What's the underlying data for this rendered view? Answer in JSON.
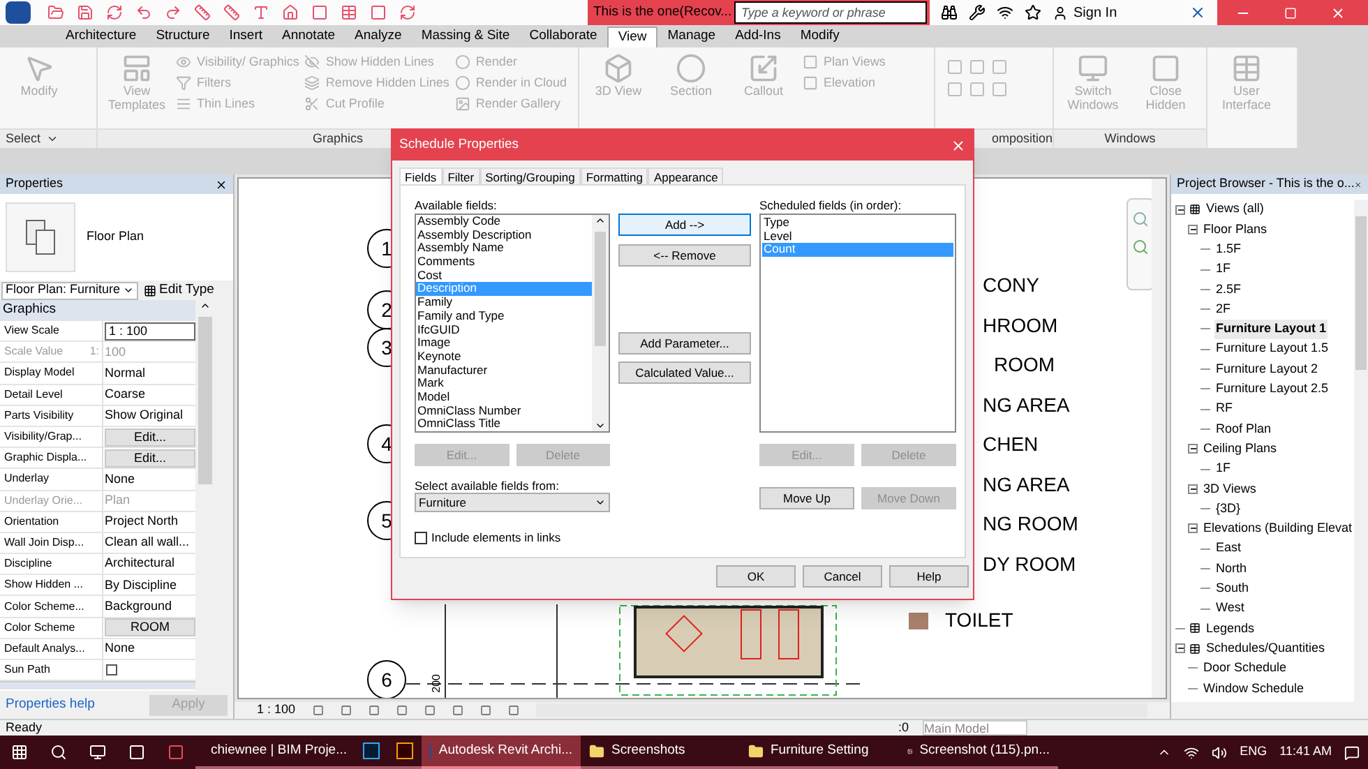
{
  "title_bar": {
    "title": "This is the one(Recov...",
    "search": {
      "placeholder": "Type a keyword or phrase"
    },
    "sign_in": "Sign In"
  },
  "ribbon_tabs": [
    {
      "label": "Architecture",
      "selected": false
    },
    {
      "label": "Structure",
      "selected": false
    },
    {
      "label": "Insert",
      "selected": false
    },
    {
      "label": "Annotate",
      "selected": false
    },
    {
      "label": "Analyze",
      "selected": false
    },
    {
      "label": "Massing & Site",
      "selected": false
    },
    {
      "label": "Collaborate",
      "selected": false
    },
    {
      "label": "View",
      "selected": true
    },
    {
      "label": "Manage",
      "selected": false
    },
    {
      "label": "Add-Ins",
      "selected": false
    },
    {
      "label": "Modify",
      "selected": false
    }
  ],
  "ribbon": [
    {
      "label": "Select",
      "columns": [
        [
          {
            "label": "Modify",
            "kind": "large"
          }
        ]
      ]
    },
    {
      "label": "Graphics",
      "columns": [
        [
          {
            "label": "View Templates",
            "kind": "large"
          }
        ],
        [
          {
            "label": "Visibility/ Graphics",
            "kind": "small"
          },
          {
            "label": "Filters",
            "kind": "small"
          },
          {
            "label": "Thin Lines",
            "kind": "small"
          }
        ],
        [
          {
            "label": "Show Hidden Lines",
            "kind": "small"
          },
          {
            "label": "Remove Hidden Lines",
            "kind": "small"
          },
          {
            "label": "Cut Profile",
            "kind": "small"
          }
        ],
        [
          {
            "label": "Render",
            "kind": "small"
          },
          {
            "label": "Render in Cloud",
            "kind": "small"
          },
          {
            "label": "Render Gallery",
            "kind": "small"
          }
        ]
      ]
    },
    {
      "columns": [
        [
          {
            "label": "3D View",
            "kind": "large"
          }
        ],
        [
          {
            "label": "Section",
            "kind": "large"
          }
        ],
        [
          {
            "label": "Callout",
            "kind": "large"
          }
        ],
        [
          {
            "label": "Plan Views",
            "kind": "small"
          },
          {
            "label": "Elevation",
            "kind": "small"
          }
        ]
      ]
    },
    {
      "label": "omposition"
    },
    {
      "label": "Windows",
      "columns": [
        [
          {
            "label": "Switch Windows",
            "kind": "large"
          }
        ],
        [
          {
            "label": "Close Hidden",
            "kind": "large"
          }
        ]
      ]
    },
    {
      "columns": [
        [
          {
            "label": "User Interface",
            "kind": "large"
          }
        ]
      ]
    }
  ],
  "properties": {
    "title": "Properties",
    "type_name": "Floor Plan",
    "type_selector": "Floor Plan: Furniture",
    "edit_type": "Edit Type",
    "section": "Graphics",
    "rows": [
      {
        "name": "View Scale",
        "value": "1 : 100",
        "kind": "field",
        "disabled": false
      },
      {
        "name": "Scale Value",
        "unit": "1:",
        "value": "100",
        "kind": "text",
        "disabled": true
      },
      {
        "name": "Display Model",
        "value": "Normal",
        "kind": "text",
        "disabled": false
      },
      {
        "name": "Detail Level",
        "value": "Coarse",
        "kind": "text",
        "disabled": false
      },
      {
        "name": "Parts Visibility",
        "value": "Show Original",
        "kind": "text",
        "disabled": false
      },
      {
        "name": "Visibility/Grap...",
        "value": "Edit...",
        "kind": "button",
        "disabled": false
      },
      {
        "name": "Graphic Displa...",
        "value": "Edit...",
        "kind": "button",
        "disabled": false
      },
      {
        "name": "Underlay",
        "value": "None",
        "kind": "text",
        "disabled": false
      },
      {
        "name": "Underlay Orie...",
        "value": "Plan",
        "kind": "text",
        "disabled": true
      },
      {
        "name": "Orientation",
        "value": "Project North",
        "kind": "text",
        "disabled": false
      },
      {
        "name": "Wall Join Disp...",
        "value": "Clean all wall...",
        "kind": "text",
        "disabled": false
      },
      {
        "name": "Discipline",
        "value": "Architectural",
        "kind": "text",
        "disabled": false
      },
      {
        "name": "Show Hidden ...",
        "value": "By Discipline",
        "kind": "text",
        "disabled": false
      },
      {
        "name": "Color Scheme...",
        "value": "Background",
        "kind": "text",
        "disabled": false
      },
      {
        "name": "Color Scheme",
        "value": "ROOM",
        "kind": "button",
        "disabled": false
      },
      {
        "name": "Default Analys...",
        "value": "None",
        "kind": "text",
        "disabled": false
      },
      {
        "name": "Sun Path",
        "kind": "checkbox",
        "checked": false,
        "disabled": false
      }
    ],
    "help": "Properties help",
    "apply": "Apply"
  },
  "canvas": {
    "bubbles": [
      "1",
      "2",
      "3",
      "4",
      "5",
      "6"
    ],
    "room_labels": [
      {
        "label": "CONY",
        "swatch": false
      },
      {
        "label": "HROOM",
        "swatch": false
      },
      {
        "label": "ROOM",
        "swatch": false
      },
      {
        "label": "NG AREA",
        "swatch": false
      },
      {
        "label": "CHEN",
        "swatch": false
      },
      {
        "label": "NG AREA",
        "swatch": false
      },
      {
        "label": "NG ROOM",
        "swatch": false
      },
      {
        "label": "DY ROOM",
        "swatch": false
      },
      {
        "label": "TOILET",
        "swatch": true,
        "color": "#a9806c"
      }
    ],
    "dimension": "200",
    "scale": "1 : 100"
  },
  "project_browser": {
    "title": "Project Browser - This is the o...",
    "tree": [
      {
        "label": "Views (all)",
        "kind": "views",
        "expanded": true,
        "selected": false,
        "children": [
          {
            "label": "Floor Plans",
            "expanded": true,
            "selected": false,
            "children": [
              {
                "label": "1.5F",
                "selected": false
              },
              {
                "label": "1F",
                "selected": false
              },
              {
                "label": "2.5F",
                "selected": false
              },
              {
                "label": "2F",
                "selected": false
              },
              {
                "label": "Furniture Layout 1",
                "selected": true
              },
              {
                "label": "Furniture Layout 1.5",
                "selected": false
              },
              {
                "label": "Furniture Layout 2",
                "selected": false
              },
              {
                "label": "Furniture Layout 2.5",
                "selected": false
              },
              {
                "label": "RF",
                "selected": false
              },
              {
                "label": "Roof Plan",
                "selected": false
              }
            ]
          },
          {
            "label": "Ceiling Plans",
            "expanded": true,
            "selected": false,
            "children": [
              {
                "label": "1F",
                "selected": false
              }
            ]
          },
          {
            "label": "3D Views",
            "expanded": true,
            "selected": false,
            "children": [
              {
                "label": "{3D}",
                "selected": false
              }
            ]
          },
          {
            "label": "Elevations (Building Elevat",
            "expanded": true,
            "selected": false,
            "children": [
              {
                "label": "East",
                "selected": false
              },
              {
                "label": "North",
                "selected": false
              },
              {
                "label": "South",
                "selected": false
              },
              {
                "label": "West",
                "selected": false
              }
            ]
          }
        ]
      },
      {
        "label": "Legends",
        "kind": "legends",
        "selected": false
      },
      {
        "label": "Schedules/Quantities",
        "kind": "schedules",
        "expanded": true,
        "selected": false,
        "children": [
          {
            "label": "Door Schedule",
            "selected": false
          },
          {
            "label": "Window Schedule",
            "selected": false
          }
        ]
      }
    ]
  },
  "status_bar": {
    "text": "Ready",
    "count": ":0",
    "model": "Main Model"
  },
  "dialog": {
    "title": "Schedule Properties",
    "tabs": [
      {
        "label": "Fields",
        "selected": true
      },
      {
        "label": "Filter",
        "selected": false
      },
      {
        "label": "Sorting/Grouping",
        "selected": false
      },
      {
        "label": "Formatting",
        "selected": false
      },
      {
        "label": "Appearance",
        "selected": false
      }
    ],
    "available_label": "Available fields:",
    "available": [
      {
        "label": "Assembly Code",
        "selected": false
      },
      {
        "label": "Assembly Description",
        "selected": false
      },
      {
        "label": "Assembly Name",
        "selected": false
      },
      {
        "label": "Comments",
        "selected": false
      },
      {
        "label": "Cost",
        "selected": false
      },
      {
        "label": "Description",
        "selected": true
      },
      {
        "label": "Family",
        "selected": false
      },
      {
        "label": "Family and Type",
        "selected": false
      },
      {
        "label": "IfcGUID",
        "selected": false
      },
      {
        "label": "Image",
        "selected": false
      },
      {
        "label": "Keynote",
        "selected": false
      },
      {
        "label": "Manufacturer",
        "selected": false
      },
      {
        "label": "Mark",
        "selected": false
      },
      {
        "label": "Model",
        "selected": false
      },
      {
        "label": "OmniClass Number",
        "selected": false
      },
      {
        "label": "OmniClass Title",
        "selected": false
      }
    ],
    "add": "Add -->",
    "remove": "<-- Remove",
    "add_parameter": "Add Parameter...",
    "calculated": "Calculated Value...",
    "scheduled_label": "Scheduled fields (in order):",
    "scheduled": [
      {
        "label": "Type",
        "selected": false
      },
      {
        "label": "Level",
        "selected": false
      },
      {
        "label": "Count",
        "selected": true
      }
    ],
    "left_buttons": [
      {
        "label": "Edit...",
        "disabled": true
      },
      {
        "label": "Delete",
        "disabled": true
      }
    ],
    "right_buttons": [
      {
        "label": "Edit...",
        "disabled": true
      },
      {
        "label": "Delete",
        "disabled": true
      }
    ],
    "from_label": "Select available fields from:",
    "from_value": "Furniture",
    "move_buttons": [
      {
        "label": "Move Up",
        "disabled": false
      },
      {
        "label": "Move Down",
        "disabled": true
      }
    ],
    "include_links": {
      "label": "Include elements in links",
      "checked": false
    },
    "footer_buttons": [
      "OK",
      "Cancel",
      "Help"
    ]
  },
  "taskbar": {
    "apps": [
      {
        "label": "chiewnee | BIM Proje...",
        "kind": "browser",
        "selected": false
      },
      {
        "kind": "ps",
        "selected": false
      },
      {
        "kind": "ai",
        "selected": false
      },
      {
        "label": "Autodesk Revit Archi...",
        "kind": "revit",
        "selected": true
      },
      {
        "label": "Screenshots",
        "kind": "folder",
        "selected": false
      },
      {
        "label": "Furniture Setting",
        "kind": "folder",
        "selected": false
      },
      {
        "label": "Screenshot (115).pn...",
        "kind": "image",
        "selected": false
      }
    ],
    "language": "ENG",
    "time": "11:41 AM"
  }
}
